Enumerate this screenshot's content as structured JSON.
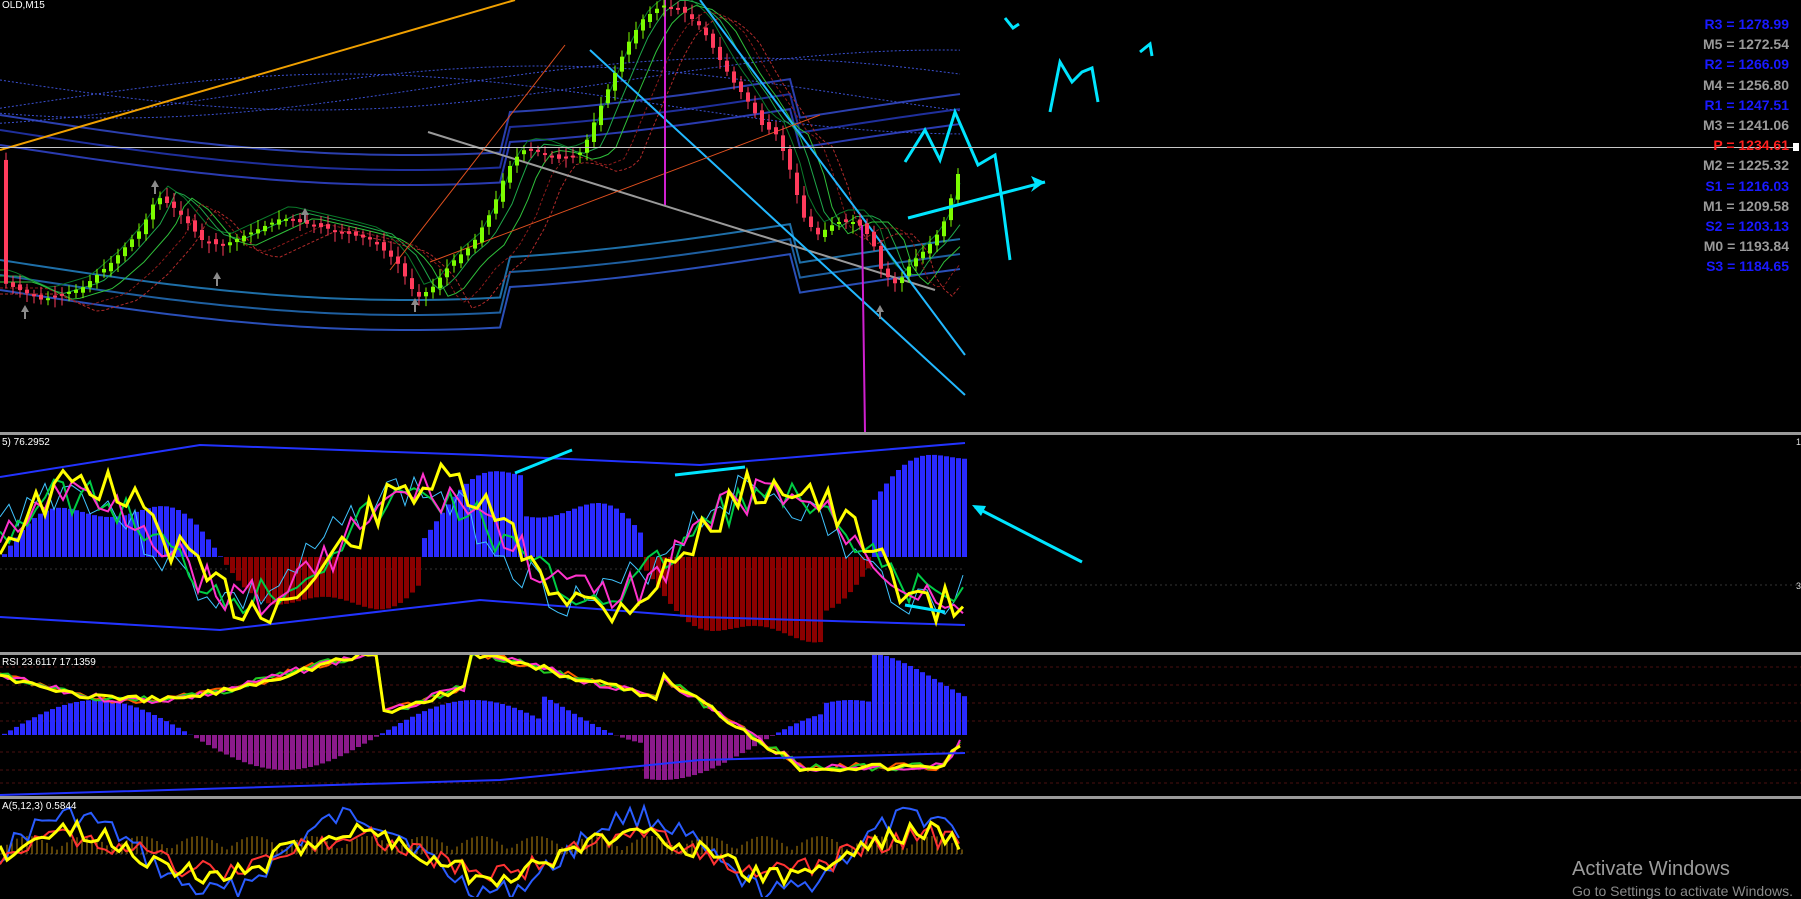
{
  "main": {
    "title": "OLD,M15",
    "pivots": [
      {
        "label": "R3 = 1278.99",
        "color": "#1a1aff"
      },
      {
        "label": "M5 = 1272.54",
        "color": "#9a9a9a"
      },
      {
        "label": "R2 = 1266.09",
        "color": "#1a1aff"
      },
      {
        "label": "M4 = 1256.80",
        "color": "#9a9a9a"
      },
      {
        "label": "R1 = 1247.51",
        "color": "#1a1aff"
      },
      {
        "label": "M3 = 1241.06",
        "color": "#9a9a9a"
      },
      {
        "label": "P   = 1234.61",
        "color": "#ff2020"
      },
      {
        "label": "M2 = 1225.32",
        "color": "#9a9a9a"
      },
      {
        "label": "S1 = 1216.03",
        "color": "#1a1aff"
      },
      {
        "label": "M1 = 1209.58",
        "color": "#9a9a9a"
      },
      {
        "label": "S2 = 1203.13",
        "color": "#1a1aff"
      },
      {
        "label": "M0 = 1193.84",
        "color": "#9a9a9a"
      },
      {
        "label": "S3 = 1184.65",
        "color": "#1a1aff"
      }
    ]
  },
  "pane1": {
    "label": "5) 76.2952"
  },
  "pane2": {
    "label": "RSI 23.6117 17.1359"
  },
  "pane3": {
    "label": "A(5,12,3) 0.5844"
  },
  "watermark": {
    "line1": "Activate Windows",
    "line2": "Go to Settings to activate Windows."
  },
  "colors": {
    "bull": "#7CFC00",
    "bear": "#ff3b5c",
    "hist_pos": "#2a2aff",
    "hist_neg_1": "#8b0000",
    "hist_neg_2": "#8b1a8b",
    "stoch_main": "#ffff00",
    "annotation": "#00e5ff"
  }
}
